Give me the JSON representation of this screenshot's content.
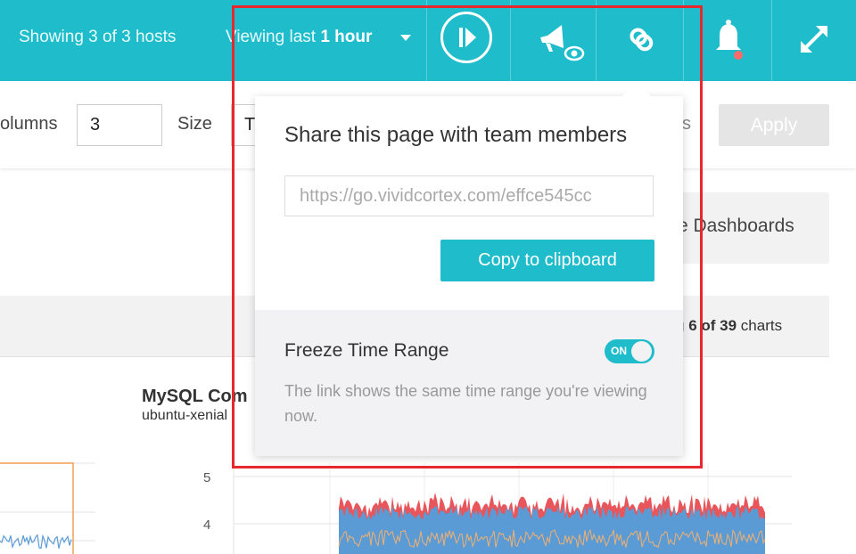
{
  "topbar": {
    "hosts_text": "Showing 3 of 3 hosts",
    "viewing_prefix": "Viewing last",
    "viewing_value": "1 hour"
  },
  "toolbar": {
    "columns_label": "olumns",
    "columns_value": "3",
    "size_label": "Size",
    "size_value": "T",
    "partial_text": "s",
    "apply_label": "Apply"
  },
  "main": {
    "dashboards_label": "e Dashboards",
    "charts_count": {
      "prefix": "g",
      "shown": "6 of 39",
      "suffix": "charts"
    },
    "chart": {
      "title": "MySQL Com",
      "subtitle": "ubuntu-xenial",
      "y_ticks": [
        "5",
        "4"
      ]
    }
  },
  "popover": {
    "title": "Share this page with team members",
    "url_value": "https://go.vividcortex.com/effce545cc",
    "copy_label": "Copy to clipboard",
    "freeze_label": "Freeze Time Range",
    "toggle_label": "ON",
    "toggle_state": "on",
    "freeze_description": "The link shows the same time range you're viewing now."
  },
  "colors": {
    "accent": "#1fbccc",
    "highlight": "#e8282f",
    "notification": "#ff6b6b",
    "series_blue": "#5b9bd5",
    "series_orange": "#f0a050",
    "series_red": "#e8555a"
  }
}
